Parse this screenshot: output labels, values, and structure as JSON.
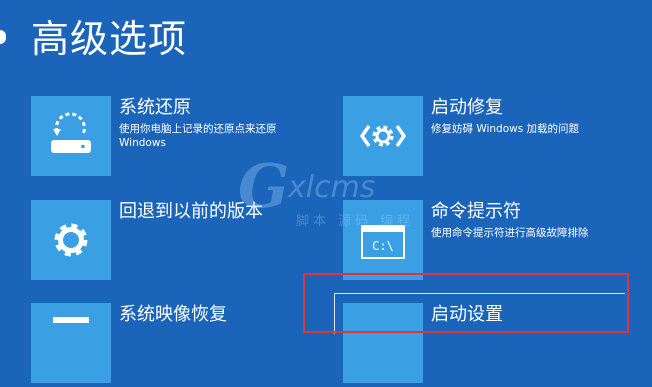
{
  "page": {
    "title": "高级选项",
    "background": "#1a64b9",
    "tile_color": "#3b9fe4",
    "highlight_color": "#d9363e"
  },
  "options": [
    {
      "title": "系统还原",
      "desc": "使用你电脑上记录的还原点来还原 Windows",
      "icon": "system-restore-icon"
    },
    {
      "title": "启动修复",
      "desc": "修复妨碍 Windows 加载的问题",
      "icon": "code-gear-icon"
    },
    {
      "title": "回退到以前的版本",
      "desc": "",
      "icon": "gear-icon"
    },
    {
      "title": "命令提示符",
      "desc": "使用命令提示符进行高级故障排除",
      "icon": "command-prompt-icon"
    },
    {
      "title": "系统映像恢复",
      "desc": "",
      "icon": "system-image-icon"
    },
    {
      "title": "启动设置",
      "desc": "",
      "icon": "startup-settings-icon"
    }
  ],
  "icons": {
    "cmd_text": "C:\\"
  },
  "watermark": {
    "logo": "G",
    "text": "xlcms",
    "sub": "脚本 源码 编程"
  }
}
